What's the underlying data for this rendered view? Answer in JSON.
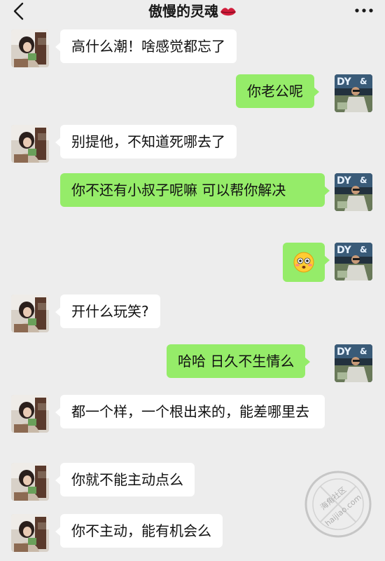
{
  "header": {
    "title": "傲慢的灵魂",
    "back_icon": "chevron-left-icon",
    "title_emoji": "lips-icon",
    "more_icon": "more-dots-icon"
  },
  "colors": {
    "background": "#ededed",
    "sent_bubble": "#95ec69",
    "received_bubble": "#ffffff"
  },
  "messages": [
    {
      "side": "left",
      "text": "高什么潮！啥感觉都忘了"
    },
    {
      "side": "right",
      "text": "你老公呢"
    },
    {
      "side": "left",
      "text": "别提他，不知道死哪去了"
    },
    {
      "side": "right",
      "text": "你不还有小叔子呢嘛  可以帮你解决"
    },
    {
      "side": "right",
      "emoji": "flushed-face-icon"
    },
    {
      "side": "left",
      "text": "开什么玩笑?"
    },
    {
      "side": "right",
      "text": "哈哈 日久不生情么"
    },
    {
      "side": "left",
      "text": "都一个样，一个根出来的，能差哪里去"
    },
    {
      "side": "left",
      "text": "你就不能主动点么"
    },
    {
      "side": "left",
      "text": "你不主动，能有机会么"
    }
  ],
  "avatar_me_text": "DY",
  "avatar_me_symbol": "&",
  "watermark": {
    "site_cn": "海角社区",
    "url": "haijiao.com"
  }
}
